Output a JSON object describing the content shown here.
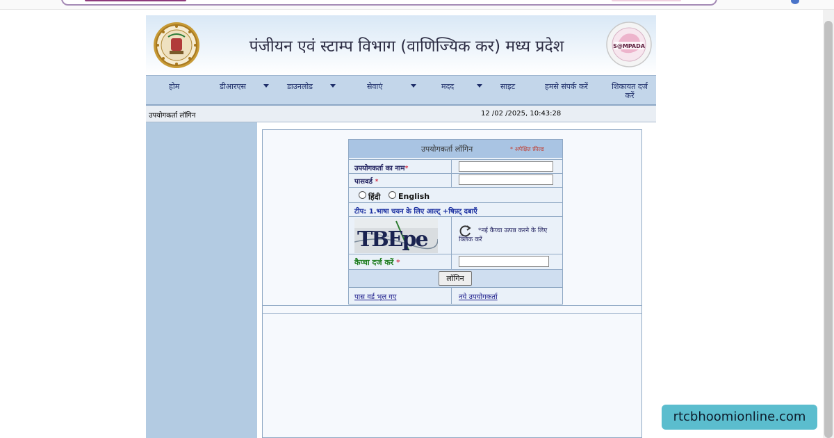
{
  "header": {
    "site_title": "पंजीयन एवं स्टाम्प विभाग (वाणिज्यिक कर) मध्य प्रदेश",
    "sampada_logo_text": "S@MPADA"
  },
  "nav": {
    "items": [
      {
        "label": "होम",
        "has_dropdown": false
      },
      {
        "label": "डीआरएस",
        "has_dropdown": true
      },
      {
        "label": "डाउनलोड",
        "has_dropdown": true
      },
      {
        "label": "सेवाएं",
        "has_dropdown": true
      },
      {
        "label": "मदद",
        "has_dropdown": true
      },
      {
        "label": "साइट",
        "has_dropdown": false
      },
      {
        "label": "हमसे संपर्क करें",
        "has_dropdown": false
      },
      {
        "label": "शिकायत दर्ज करें",
        "has_dropdown": false
      }
    ]
  },
  "status": {
    "user_login": "उपयोगकर्ता लॉगिन",
    "datetime": "12 /02 /2025, 10:43:28"
  },
  "login": {
    "title": "उपयोगकर्ता लॉगिन",
    "required_note": "* अपेक्षित फ़ील्ड",
    "username_label": "उपयोगकर्ता का नाम",
    "username_value": "",
    "password_label": "पासवर्ड",
    "password_value": "",
    "required_star": "*",
    "lang_hindi": "हिंदी",
    "lang_english": "English",
    "tip": "टीप: 1.भाषा चयन के लिए आल्ट् +षिफ़्ट् दबाएँ",
    "captcha_text": "TBEpe",
    "refresh_text": "*नई कैप्चा उत्पन्न करने के लिए क्लिक करें",
    "captcha_label": "कैप्चा दर्ज करें",
    "captcha_value": "",
    "login_button": "लॉगिन",
    "forgot_password": "पास वर्ड भूल गए",
    "new_user": "नये उपयोगकर्ता"
  },
  "watermark": "rtcbhoomionline.com",
  "colors": {
    "nav_bg": "#c3d6ea",
    "left_panel": "#b3cbe2",
    "login_head": "#a9c4e3",
    "tip_blue": "#1a2fa0",
    "captcha_label_green": "#1a7a1a",
    "watermark_bg": "#5bbdce"
  }
}
